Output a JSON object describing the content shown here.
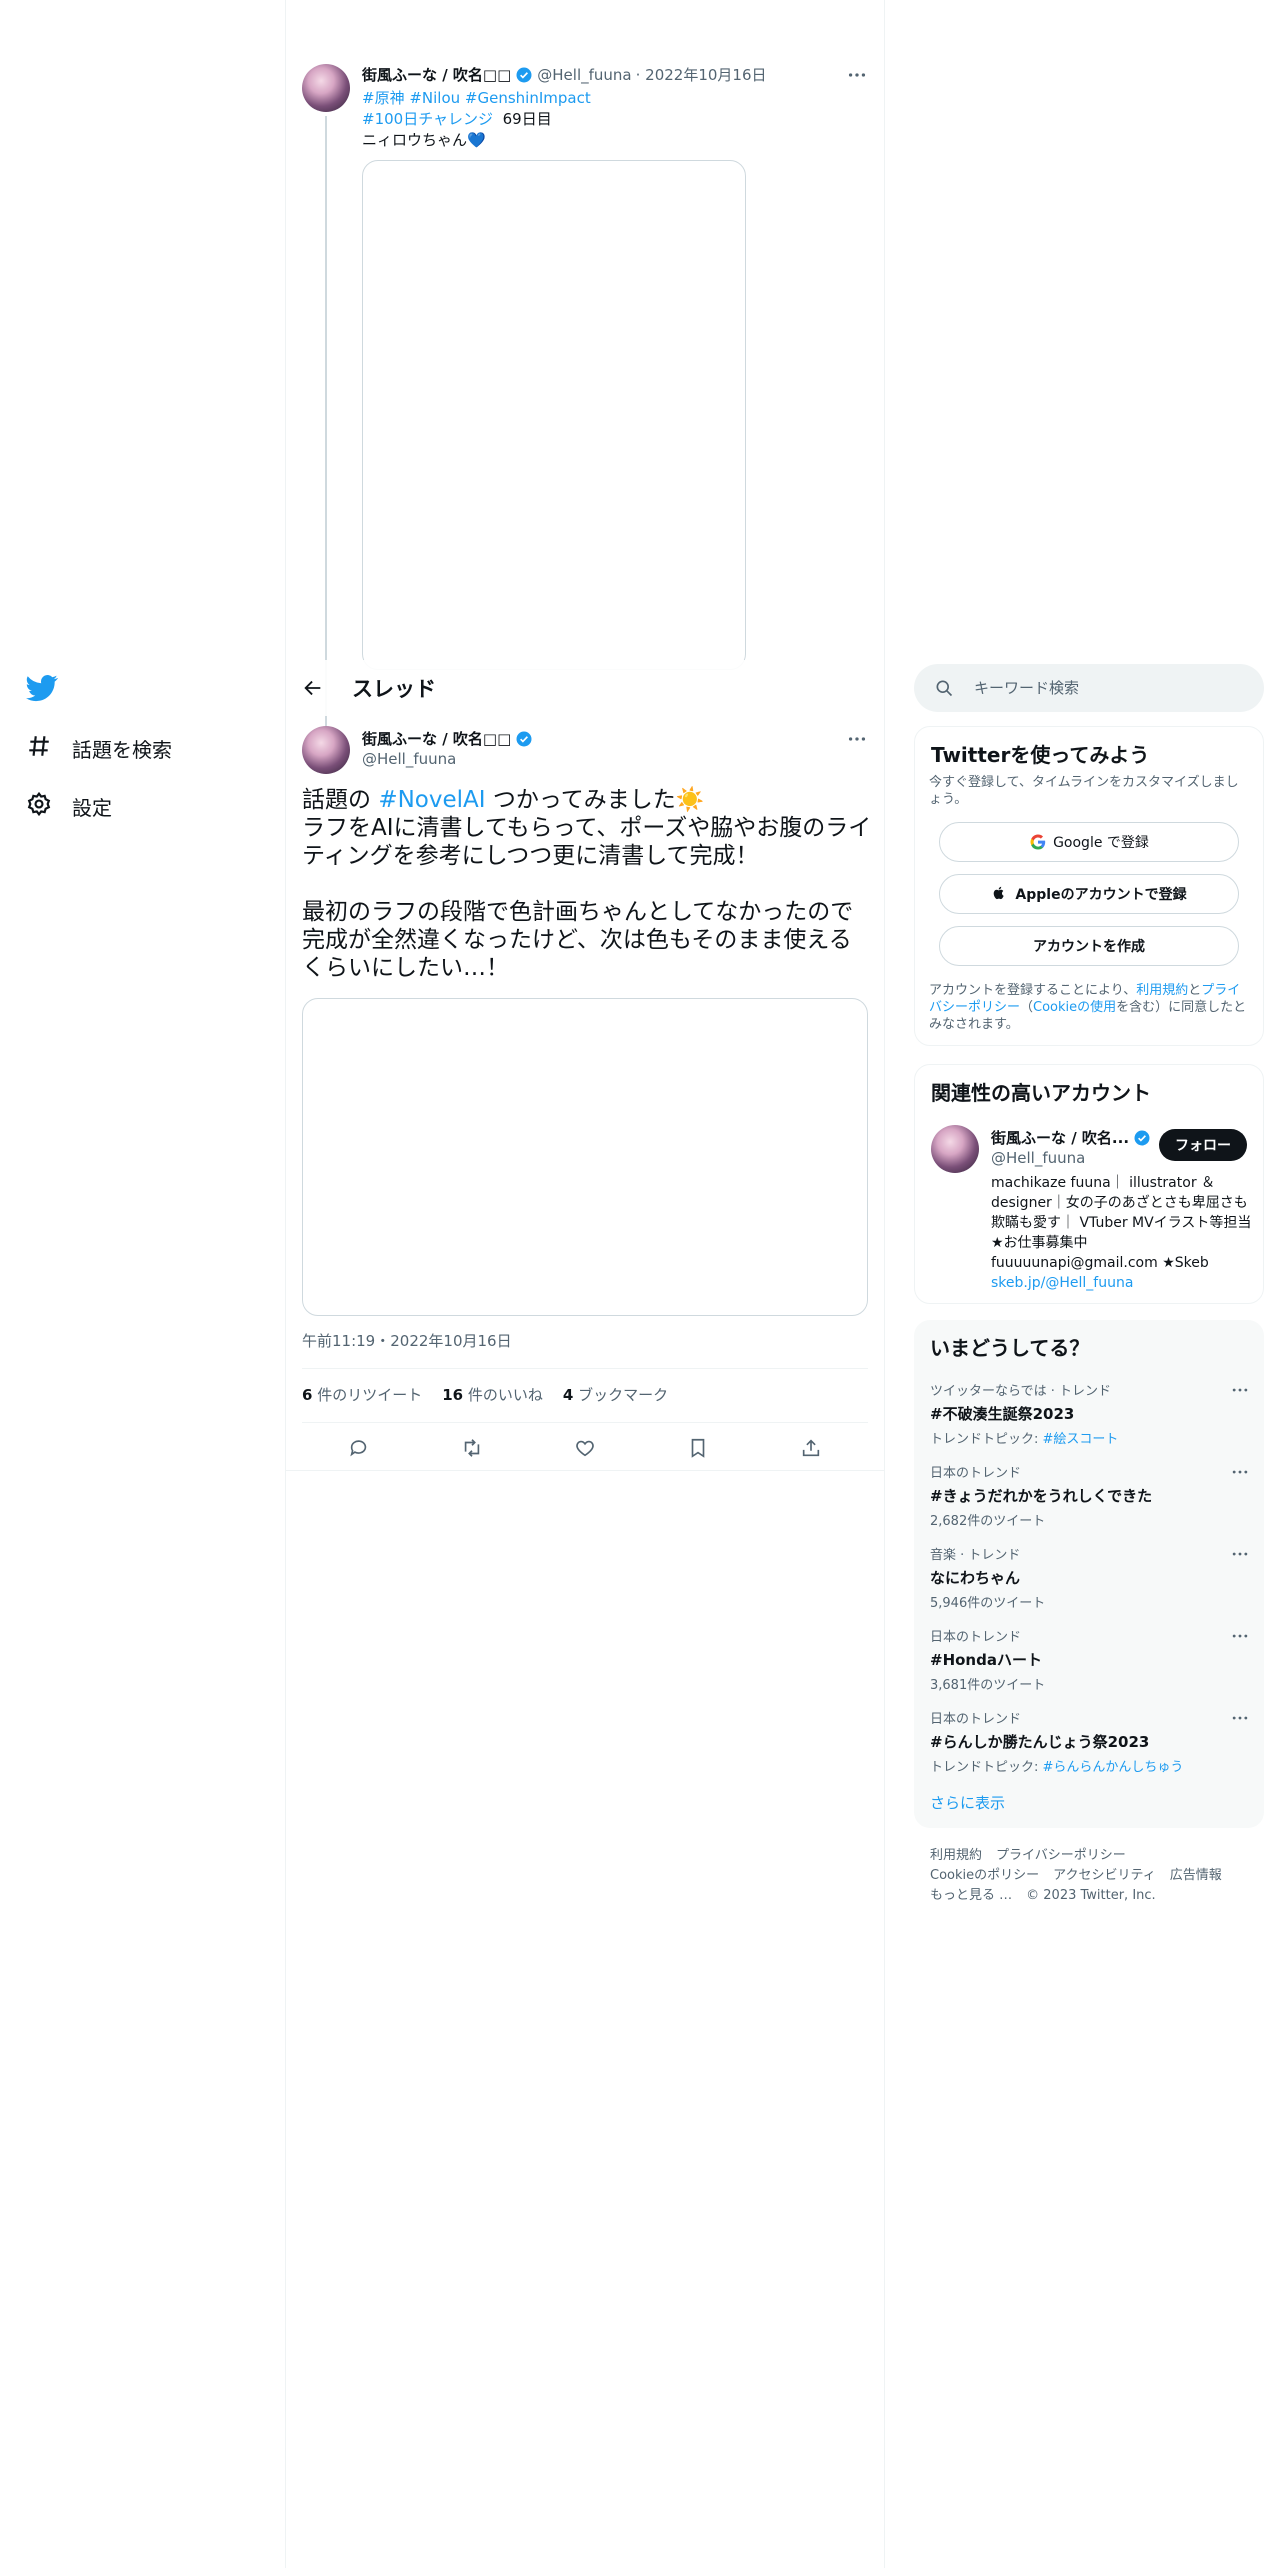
{
  "nav": {
    "logo": "twitter-bird-icon",
    "items": [
      {
        "label": "話題を検索",
        "icon": "hashtag-icon"
      },
      {
        "label": "設定",
        "icon": "gear-icon"
      }
    ]
  },
  "parent_tweet": {
    "name": "街風ふーな / 吹名□□",
    "handle": "@Hell_fuuna",
    "date": "· 2022年10月16日",
    "tags_line1": "#原神 #Nilou #GenshinImpact",
    "tags_line2": "#100日チャレンジ",
    "day": "69日目",
    "text": "ニィロウちゃん💙"
  },
  "header": {
    "title": "スレッド"
  },
  "main_tweet": {
    "name": "街風ふーな / 吹名□□",
    "handle": "@Hell_fuuna",
    "text_prefix": "話題の ",
    "hashtag": "#NovelAI",
    "text_rest": " つかってみました☀️\nラフをAIに清書してもらって、ポーズや脇やお腹のライティングを参考にしつつ更に清書して完成！\n\n最初のラフの段階で色計画ちゃんとしてなかったので完成が全然違くなったけど、次は色もそのまま使えるくらいにしたい…！",
    "timestamp": "午前11:19・2022年10月16日",
    "retweets": "6",
    "retweets_label": "件のリツイート",
    "likes": "16",
    "likes_label": "件のいいね",
    "bookmarks": "4",
    "bookmarks_label": "ブックマーク"
  },
  "search": {
    "placeholder": "キーワード検索"
  },
  "signup": {
    "title": "Twitterを使ってみよう",
    "subtitle": "今すぐ登録して、タイムラインをカスタマイズしましょう。",
    "google": "Google で登録",
    "apple": "Appleのアカウントで登録",
    "create": "アカウントを作成",
    "legal_1": "アカウントを登録することにより、",
    "legal_terms": "利用規約",
    "legal_2": "と",
    "legal_privacy": "プライバシーポリシー",
    "legal_3": "（",
    "legal_cookie": "Cookieの使用",
    "legal_4": "を含む）に同意したとみなされます。"
  },
  "related": {
    "title": "関連性の高いアカウント",
    "name": "街風ふーな / 吹名...",
    "handle": "@Hell_fuuna",
    "follow": "フォロー",
    "bio": "machikaze fuuna｜ illustrator ＆ designer｜女の子のあざとさも卑屈さも欺瞞も愛す｜ VTuber MVイラスト等担当 ★お仕事募集中 fuuuuunapi@gmail.com ★Skeb",
    "bio_link": "skeb.jp/@Hell_fuuna"
  },
  "trends": {
    "title": "いまどうしてる？",
    "items": [
      {
        "context": "ツイッターならでは · トレンド",
        "name": "#不破湊生誕祭2023",
        "sub": "トレンドトピック: ",
        "sub_link": "#絵スコート"
      },
      {
        "context": "日本のトレンド",
        "name": "#きょうだれかをうれしくできた",
        "sub": "2,682件のツイート",
        "sub_link": ""
      },
      {
        "context": "音楽 · トレンド",
        "name": "なにわちゃん",
        "sub": "5,946件のツイート",
        "sub_link": ""
      },
      {
        "context": "日本のトレンド",
        "name": "#Hondaハート",
        "sub": "3,681件のツイート",
        "sub_link": ""
      },
      {
        "context": "日本のトレンド",
        "name": "#らんしか勝たんじょう祭2023",
        "sub": "トレンドトピック: ",
        "sub_link": "#らんらんかんしちゅう"
      }
    ],
    "show_more": "さらに表示"
  },
  "footer": {
    "line1": [
      "利用規約",
      "プライバシーポリシー"
    ],
    "line2": [
      "Cookieのポリシー",
      "アクセシビリティ",
      "広告情報"
    ],
    "line3": [
      "もっと見る …",
      "© 2023 Twitter, Inc."
    ]
  },
  "colors": {
    "accent": "#1d9bf0",
    "text": "#0f1419",
    "muted": "#536471",
    "border": "#eff3f4"
  }
}
